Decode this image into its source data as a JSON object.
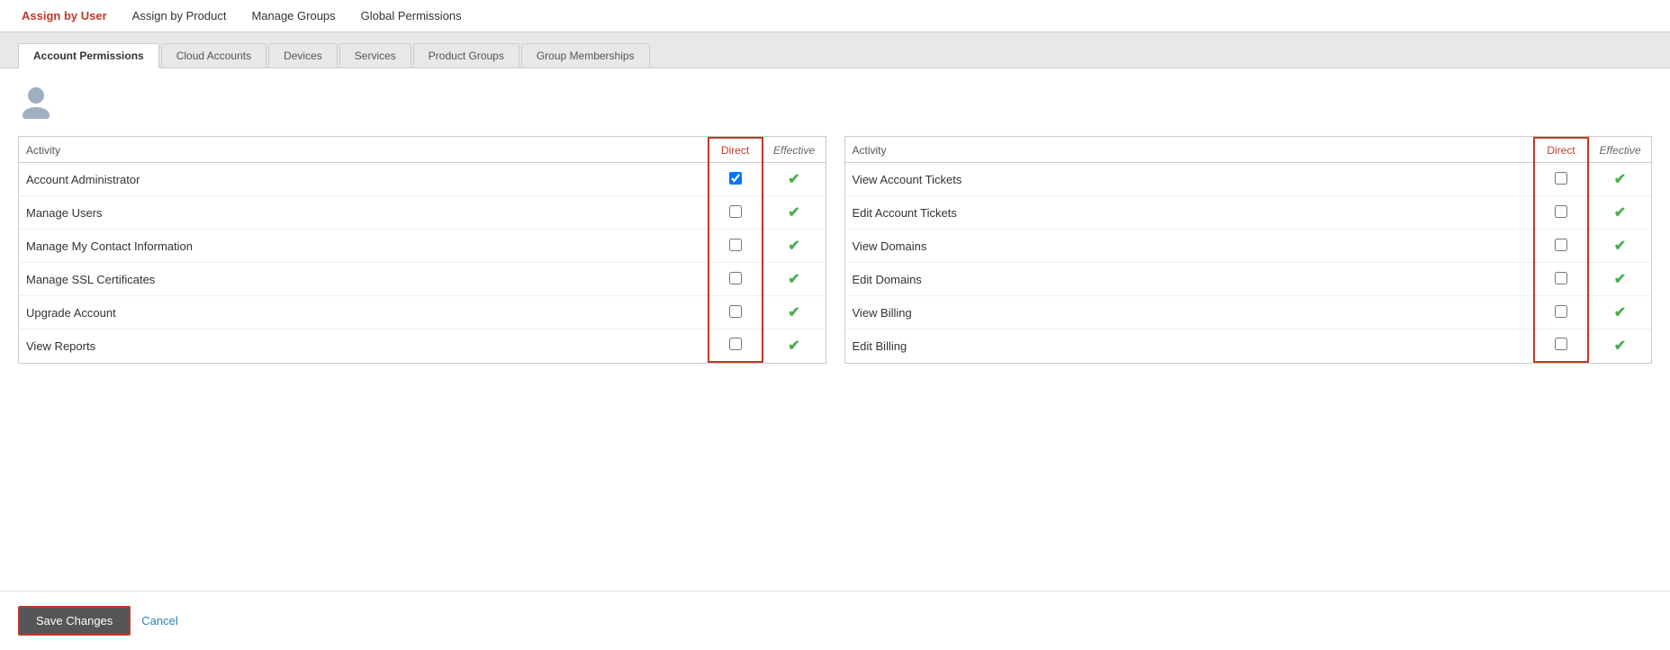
{
  "topNav": {
    "items": [
      {
        "id": "assign-by-user",
        "label": "Assign by User",
        "active": true
      },
      {
        "id": "assign-by-product",
        "label": "Assign by Product",
        "active": false
      },
      {
        "id": "manage-groups",
        "label": "Manage Groups",
        "active": false
      },
      {
        "id": "global-permissions",
        "label": "Global Permissions",
        "active": false
      }
    ]
  },
  "tabs": [
    {
      "id": "account-permissions",
      "label": "Account Permissions",
      "active": true
    },
    {
      "id": "cloud-accounts",
      "label": "Cloud Accounts",
      "active": false
    },
    {
      "id": "devices",
      "label": "Devices",
      "active": false
    },
    {
      "id": "services",
      "label": "Services",
      "active": false
    },
    {
      "id": "product-groups",
      "label": "Product Groups",
      "active": false
    },
    {
      "id": "group-memberships",
      "label": "Group Memberships",
      "active": false
    }
  ],
  "table1": {
    "header": {
      "activity": "Activity",
      "direct": "Direct",
      "effective": "Effective"
    },
    "rows": [
      {
        "id": "row1",
        "activity": "Account Administrator",
        "checked": true,
        "effective": true
      },
      {
        "id": "row2",
        "activity": "Manage Users",
        "checked": false,
        "effective": true
      },
      {
        "id": "row3",
        "activity": "Manage My Contact Information",
        "checked": false,
        "effective": true
      },
      {
        "id": "row4",
        "activity": "Manage SSL Certificates",
        "checked": false,
        "effective": true
      },
      {
        "id": "row5",
        "activity": "Upgrade Account",
        "checked": false,
        "effective": true
      },
      {
        "id": "row6",
        "activity": "View Reports",
        "checked": false,
        "effective": true
      }
    ]
  },
  "table2": {
    "header": {
      "activity": "Activity",
      "direct": "Direct",
      "effective": "Effective"
    },
    "rows": [
      {
        "id": "row1",
        "activity": "View Account Tickets",
        "checked": false,
        "effective": true
      },
      {
        "id": "row2",
        "activity": "Edit Account Tickets",
        "checked": false,
        "effective": true
      },
      {
        "id": "row3",
        "activity": "View Domains",
        "checked": false,
        "effective": true
      },
      {
        "id": "row4",
        "activity": "Edit Domains",
        "checked": false,
        "effective": true
      },
      {
        "id": "row5",
        "activity": "View Billing",
        "checked": false,
        "effective": true
      },
      {
        "id": "row6",
        "activity": "Edit Billing",
        "checked": false,
        "effective": true
      }
    ]
  },
  "footer": {
    "saveLabel": "Save Changes",
    "cancelLabel": "Cancel"
  },
  "colors": {
    "accent": "#c0392b",
    "checkmark": "#4caf50"
  }
}
